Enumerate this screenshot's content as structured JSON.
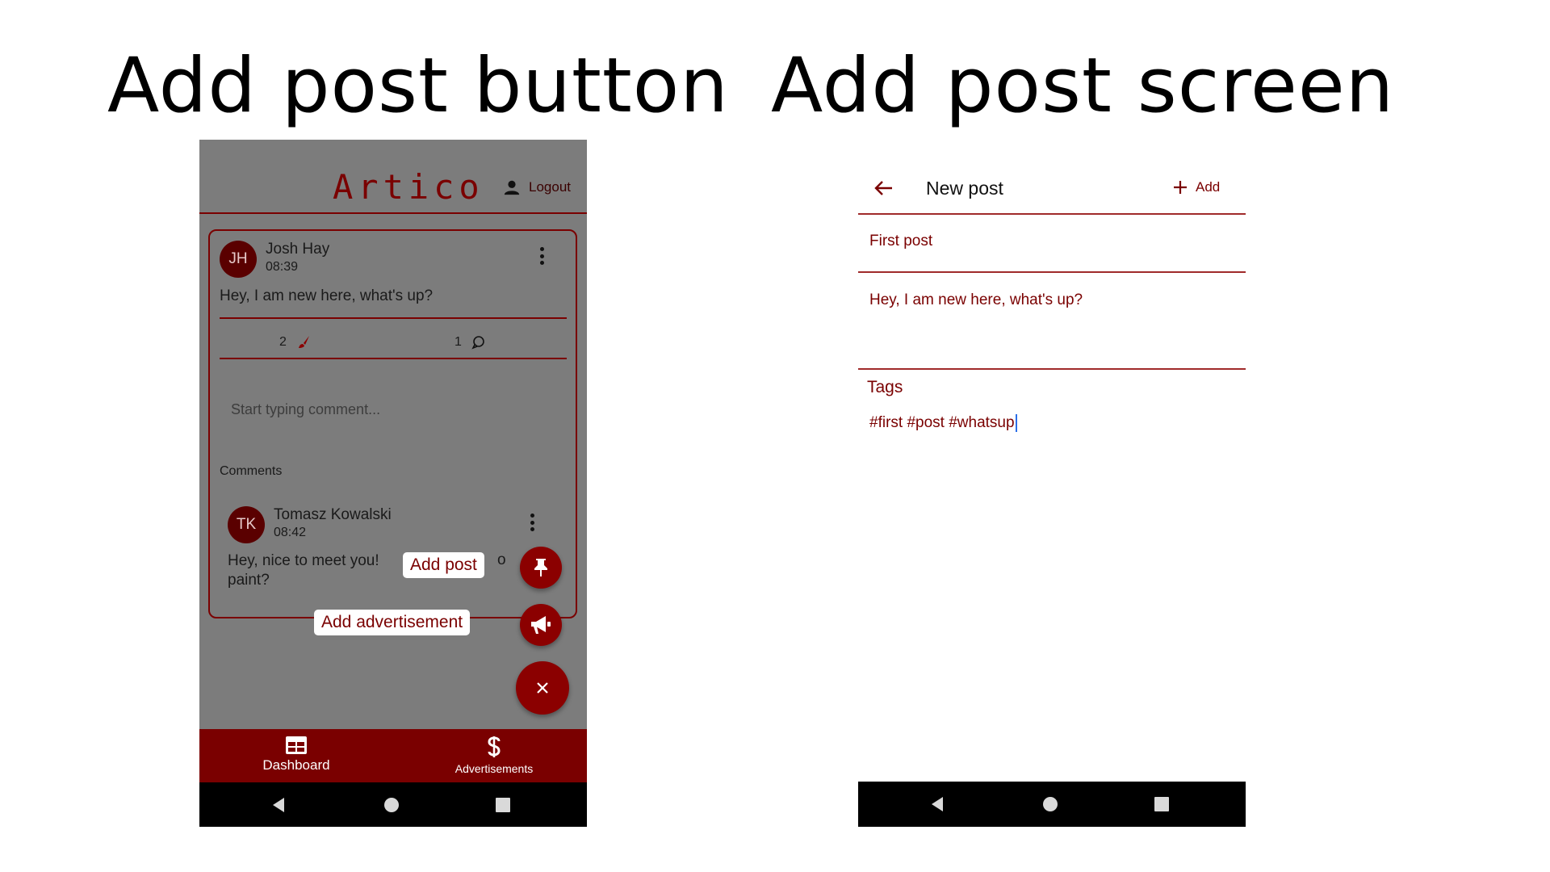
{
  "headings": {
    "left": "Add post button",
    "right": "Add post screen"
  },
  "left_screen": {
    "app_title": "Artico",
    "logout_label": "Logout",
    "post": {
      "avatar_initials": "JH",
      "author": "Josh Hay",
      "time": "08:39",
      "text": "Hey, I am new here, what's up?",
      "likes_count": "2",
      "comments_count": "1",
      "comment_placeholder": "Start typing comment...",
      "comments_label": "Comments",
      "comment": {
        "avatar_initials": "TK",
        "author": "Tomasz Kowalski",
        "time": "08:42",
        "text_visible": "Hey, nice to meet you!",
        "text_continued": "paint?",
        "text_fragment_right": "o"
      }
    },
    "fab_menu": {
      "add_post_label": "Add post",
      "add_advertisement_label": "Add advertisement",
      "add_post_icon": "pushpin-icon",
      "add_advertisement_icon": "megaphone-icon",
      "close_icon": "close-icon"
    },
    "bottom_nav": {
      "dashboard_label": "Dashboard",
      "advertisements_label": "Advertisements",
      "dashboard_icon": "table-icon",
      "advertisements_icon": "dollar-icon"
    }
  },
  "right_screen": {
    "title": "New post",
    "add_label": "Add",
    "post_title_value": "First post",
    "post_body_value": "Hey, I am new here, what's up?",
    "tags_label": "Tags",
    "tags_value": "#first #post #whatsup"
  },
  "colors": {
    "brand": "#7a0000",
    "fab": "#8b0000",
    "overlay_gray": "#7c7c7c",
    "system_bar": "#000000"
  }
}
